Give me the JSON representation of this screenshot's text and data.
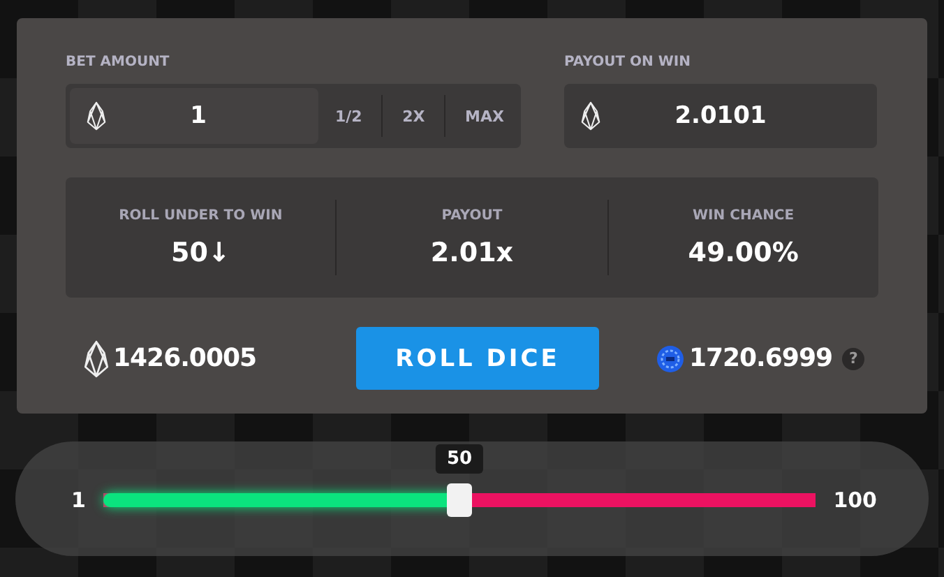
{
  "bet": {
    "label": "BET AMOUNT",
    "value": "1",
    "buttons": [
      "1/2",
      "2X",
      "MAX"
    ]
  },
  "payout_on_win": {
    "label": "PAYOUT ON WIN",
    "value": "2.0101"
  },
  "stats": [
    {
      "label": "ROLL UNDER TO WIN",
      "value": "50↓"
    },
    {
      "label": "PAYOUT",
      "value": "2.01x"
    },
    {
      "label": "WIN CHANCE",
      "value": "49.00%"
    }
  ],
  "eos_balance": "1426.0005",
  "roll_button": "ROLL DICE",
  "token_balance": "1720.6999",
  "help": "?",
  "slider": {
    "min": "1",
    "max": "100",
    "tooltip": "50",
    "level": 0.5
  }
}
